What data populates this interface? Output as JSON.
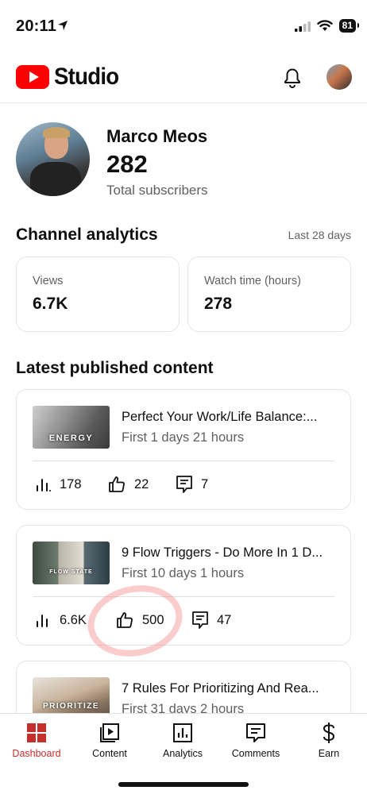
{
  "status_bar": {
    "time": "20:11",
    "battery": "81"
  },
  "header": {
    "logo_text": "Studio",
    "brand_color": "#ff0000"
  },
  "profile": {
    "name": "Marco Meos",
    "subscribers": "282",
    "subscribers_label": "Total subscribers"
  },
  "analytics": {
    "title": "Channel analytics",
    "period": "Last 28 days",
    "views": {
      "label": "Views",
      "value": "6.7K"
    },
    "watch_time": {
      "label": "Watch time (hours)",
      "value": "278"
    }
  },
  "latest": {
    "title": "Latest published content",
    "items": [
      {
        "thumb_label": "ENERGY",
        "title": "Perfect Your Work/Life Balance:...",
        "subtitle": "First 1 days 21 hours",
        "views": "178",
        "likes": "22",
        "comments": "7"
      },
      {
        "thumb_label": "FLOW STATE",
        "title": "9 Flow Triggers - Do More In 1 D...",
        "subtitle": "First 10 days 1 hours",
        "views": "6.6K",
        "likes": "500",
        "comments": "47"
      },
      {
        "thumb_label": "PRIORITIZE",
        "title": "7 Rules For Prioritizing And Rea...",
        "subtitle": "First 31 days 2 hours"
      }
    ]
  },
  "bottom_nav": {
    "active_color": "#c4302b",
    "items": [
      {
        "label": "Dashboard",
        "icon": "dashboard-icon"
      },
      {
        "label": "Content",
        "icon": "content-icon"
      },
      {
        "label": "Analytics",
        "icon": "analytics-icon"
      },
      {
        "label": "Comments",
        "icon": "comments-icon"
      },
      {
        "label": "Earn",
        "icon": "dollar-icon"
      }
    ]
  }
}
